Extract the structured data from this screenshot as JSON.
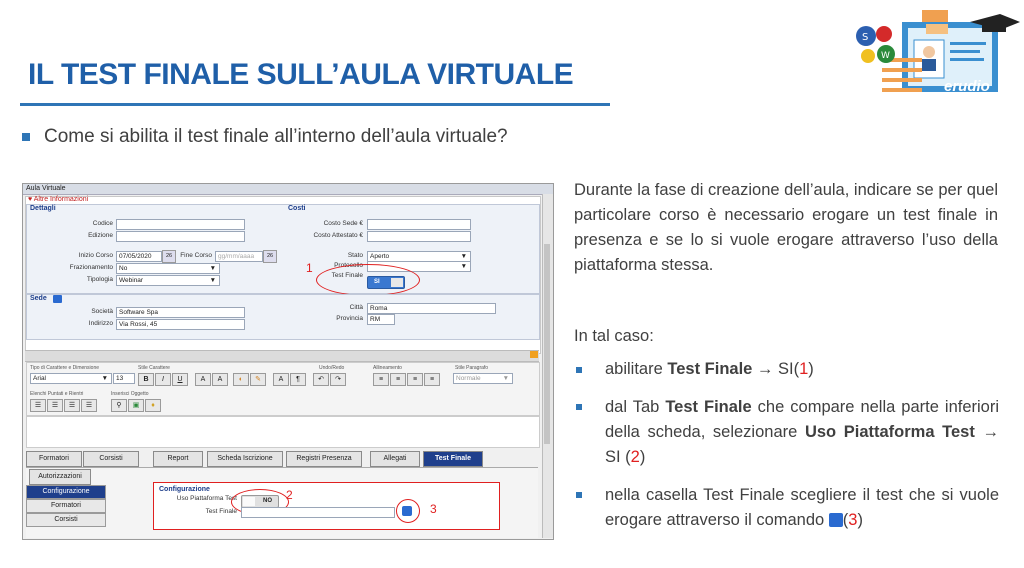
{
  "slide": {
    "title": "IL TEST FINALE SULL’AULA VIRTUALE",
    "question": "Come si abilita il test finale all’interno dell’aula virtuale?",
    "logo_text": "erudio",
    "logo_letters": [
      "S",
      "W"
    ]
  },
  "screenshot": {
    "window_title": "Aula Virtuale",
    "section_collapse": "Altre Informazioni",
    "dettagli": {
      "heading": "Dettagli",
      "codice_label": "Codice",
      "codice_value": "",
      "edizione_label": "Edizione",
      "edizione_value": "",
      "inizio_label": "Inizio Corso",
      "inizio_value": "07/05/2020",
      "fine_label": "Fine Corso",
      "fine_placeholder": "gg/mm/aaaa",
      "cal_btn": "26",
      "frazionamento_label": "Frazionamento",
      "frazionamento_value": "No",
      "tipologia_label": "Tipologia",
      "tipologia_value": "Webinar"
    },
    "costi": {
      "heading": "Costi",
      "sede_label": "Costo Sede €",
      "sede_value": "",
      "attestato_label": "Costo Attestato €",
      "attestato_value": "",
      "stato_label": "Stato",
      "stato_value": "Aperto",
      "protocollo_label": "Protocollo",
      "protocollo_value": "",
      "test_label": "Test Finale",
      "test_value": "SI"
    },
    "sede": {
      "heading": "Sede",
      "societa_label": "Società",
      "societa_value": "Software Spa",
      "indirizzo_label": "Indirizzo",
      "indirizzo_value": "Via Rossi, 45",
      "citta_label": "Città",
      "citta_value": "Roma",
      "provincia_label": "Provincia",
      "provincia_value": "RM"
    },
    "editor": {
      "font_label": "Tipo di Carattere e Dimensione",
      "font_value": "Arial",
      "size_value": "13",
      "style_label": "Stile Carattere",
      "undo_label": "Undo/Redo",
      "align_label": "Allineamento",
      "para_label": "Stile Paragrafo",
      "para_value": "Normale",
      "lists_label": "Elenchi Puntati e Rientri",
      "insert_label": "Inserisci Oggetto",
      "bold": "B",
      "italic": "I",
      "underline": "U"
    },
    "tabs": [
      "Formatori",
      "Corsisti",
      "Report",
      "Scheda Iscrizione",
      "Registri Presenza",
      "Allegati",
      "Test Finale"
    ],
    "subtab": "Autorizzazioni",
    "sidebar": [
      "Configurazione",
      "Formatori",
      "Corsisti"
    ],
    "config": {
      "heading": "Configurazione",
      "uso_label": "Uso Piattaforma Test",
      "uso_value": "NO",
      "test_label": "Test Finale",
      "test_value": ""
    },
    "markers": [
      "1",
      "2",
      "3"
    ]
  },
  "right_text": {
    "para1": "Durante la fase di creazione dell’aula, indicare se per quel particolare corso è necessario erogare un test finale in presenza e se lo si vuole erogare attraverso l’uso della piattaforma stessa.",
    "para2": "In tal caso:",
    "b1_pre": "abilitare ",
    "b1_bold": "Test Finale",
    "b1_post": " → SI(",
    "b1_num": "1",
    "b1_end": ")",
    "b2_pre": "dal Tab ",
    "b2_bold1": "Test Finale",
    "b2_mid": " che compare nella parte inferiori della scheda, selezionare ",
    "b2_bold2": "Uso Piattaforma Test",
    "b2_post": " → SI (",
    "b2_num": "2",
    "b2_end": ")",
    "b3_text": "nella casella Test Finale scegliere il test che si vuole erogare attraverso il comando ",
    "b3_num": "3",
    "b3_open": "(",
    "b3_end": ")"
  },
  "colors": {
    "title": "#1f5fa8",
    "accent": "#2e75b6",
    "marker": "#e02020",
    "active_tab": "#1f3f8c"
  }
}
